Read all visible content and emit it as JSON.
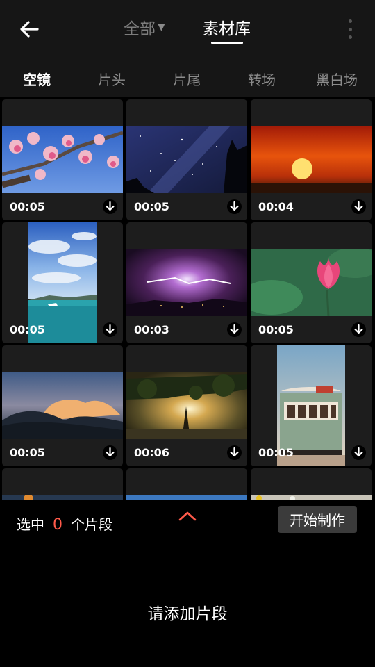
{
  "header": {
    "tab_all": "全部",
    "tab_library": "素材库"
  },
  "categories": [
    "空镜",
    "片头",
    "片尾",
    "转场",
    "黑白场"
  ],
  "clips": [
    {
      "duration": "00:05",
      "scene": "magnolia blossoms"
    },
    {
      "duration": "00:05",
      "scene": "milky way night sky"
    },
    {
      "duration": "00:04",
      "scene": "red sunset"
    },
    {
      "duration": "00:05",
      "scene": "clouds over sea"
    },
    {
      "duration": "00:03",
      "scene": "lightning storm"
    },
    {
      "duration": "00:05",
      "scene": "pink lotus"
    },
    {
      "duration": "00:05",
      "scene": "sunset clouds"
    },
    {
      "duration": "00:06",
      "scene": "sun through tree"
    },
    {
      "duration": "00:05",
      "scene": "vintage tram"
    },
    {
      "scene": "partial row"
    },
    {
      "scene": "partial row"
    },
    {
      "scene": "partial row"
    }
  ],
  "footer": {
    "selected_prefix": "选中",
    "selected_count": "0",
    "selected_suffix": "个片段",
    "start_button": "开始制作",
    "empty_hint": "请添加片段"
  },
  "colors": {
    "accent": "#ff5a4a",
    "background": "#000000",
    "bar": "#161616",
    "tile": "#1d1d1d"
  }
}
